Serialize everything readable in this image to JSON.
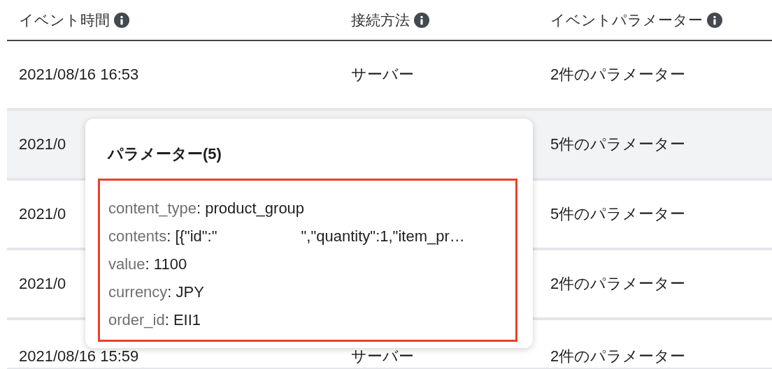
{
  "table": {
    "columns": [
      {
        "label": "イベント時間"
      },
      {
        "label": "接続方法"
      },
      {
        "label": "イベントパラメーター"
      }
    ],
    "rows": [
      {
        "cells": [
          "2021/08/16 16:53",
          "サーバー",
          "2件のパラメーター"
        ],
        "selected": false
      },
      {
        "cells": [
          "2021/0",
          null,
          "5件のパラメーター"
        ],
        "selected": true
      },
      {
        "cells": [
          "2021/0",
          null,
          "5件のパラメーター"
        ],
        "selected": false
      },
      {
        "cells": [
          "2021/0",
          null,
          "2件のパラメーター"
        ],
        "selected": false
      },
      {
        "cells": [
          "2021/08/16 15:59",
          "サーバー",
          "2件のパラメーター"
        ],
        "selected": false
      }
    ]
  },
  "popup": {
    "title": "パラメーター(5)",
    "parameters": [
      {
        "key": "content_type",
        "value": ": product_group"
      },
      {
        "key": "contents",
        "value": ": [{\"id\":\"",
        "value_after": "\",\"quantity\":1,\"item_pr…"
      },
      {
        "key": "value",
        "value": ": 1100"
      },
      {
        "key": "currency",
        "value": ": JPY"
      },
      {
        "key": "order_id",
        "value": ": EII1"
      }
    ]
  }
}
